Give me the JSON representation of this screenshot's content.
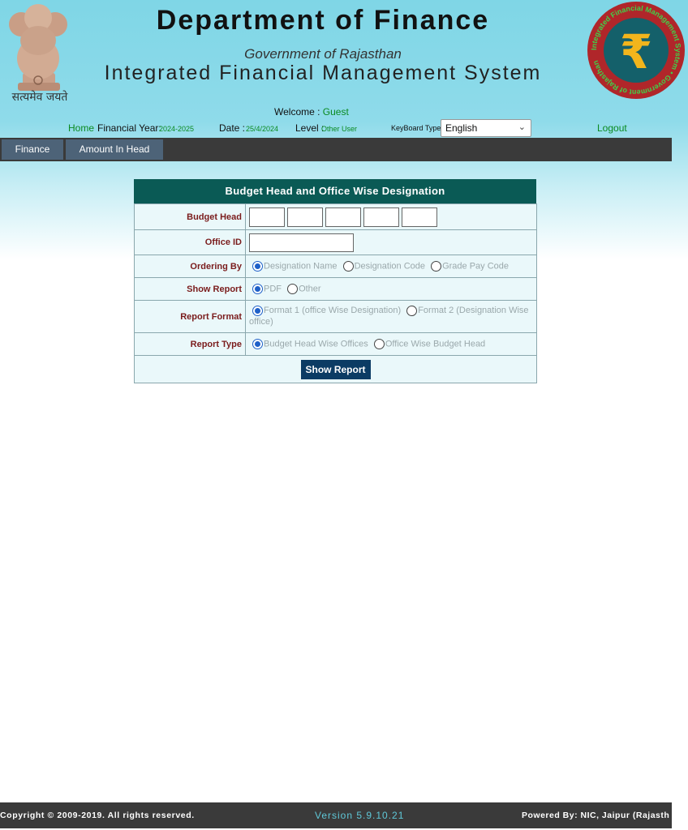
{
  "header": {
    "dept_title": "Department of Finance",
    "government": "Government of Rajasthan",
    "system_title": "Integrated Financial Management System",
    "motto": "सत्यमेव जयते",
    "logo_ring_text": "Integrated Financial Management System • Government of Rajasthan"
  },
  "infobar": {
    "welcome_label": "Welcome : ",
    "welcome_user": "Guest",
    "home": "Home",
    "fy_label": "Financial Year:",
    "fy_value": "2024-2025",
    "date_label": "Date : ",
    "date_value": "25/4/2024",
    "level_label": "Level :",
    "level_value": "Other User",
    "keyboard_label": "KeyBoard Type:",
    "keyboard_value": "English",
    "logout": "Logout"
  },
  "menu": [
    "Finance",
    "Amount In Head"
  ],
  "form": {
    "title": "Budget Head and Office Wise Designation",
    "budget_head_label": "Budget Head",
    "office_id_label": "Office ID",
    "ordering_label": "Ordering By",
    "ordering_options": [
      "Designation Name",
      "Designation Code",
      "Grade Pay Code"
    ],
    "show_report_label": "Show Report",
    "show_report_options": [
      "PDF",
      "Other"
    ],
    "report_format_label": "Report Format",
    "report_format_options": [
      "Format 1 (office Wise Designation)",
      "Format 2 (Designation Wise office)"
    ],
    "report_type_label": "Report Type",
    "report_type_options": [
      "Budget Head Wise Offices",
      "Office Wise Budget Head"
    ],
    "submit_label": "Show Report"
  },
  "footer": {
    "copyright": "Copyright © 2009-2019. All rights reserved.",
    "version": "Version 5.9.10.21",
    "powered": "Powered By: NIC, Jaipur (Rajasth"
  },
  "colors": {
    "header_bg": "#8fdbea",
    "menubar": "#3a3a3a",
    "menu_item": "#4d6378",
    "form_title": "#0a5a55",
    "label": "#7a1c1c",
    "button": "#0b3b64",
    "link": "#0a8a20",
    "version": "#5fc8d8"
  }
}
